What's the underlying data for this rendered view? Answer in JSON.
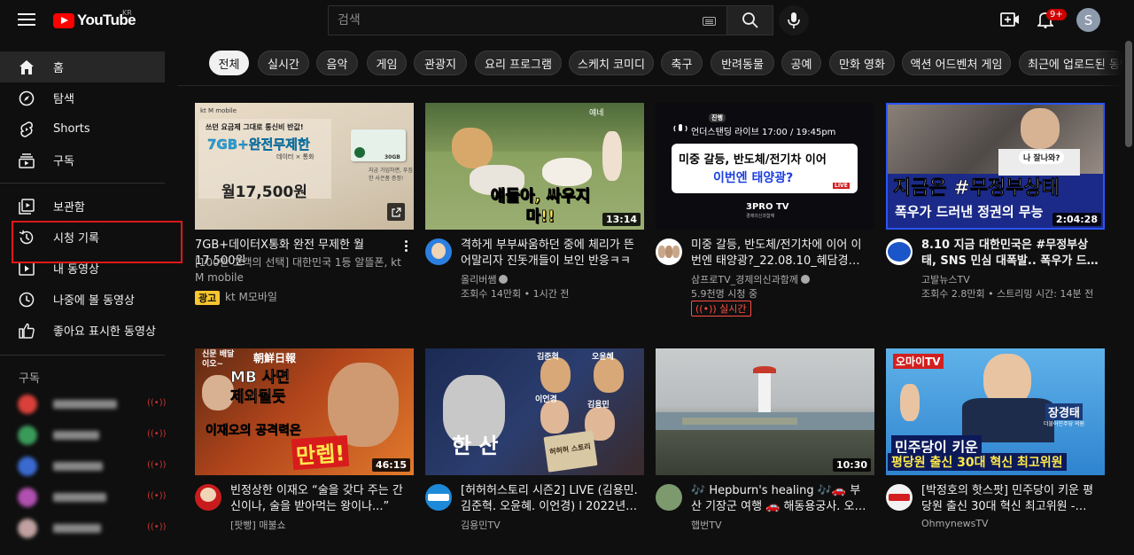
{
  "header": {
    "logo_text": "YouTube",
    "region": "KR",
    "search_placeholder": "검색",
    "notification_count": "9+",
    "avatar_letter": "S"
  },
  "sidebar": {
    "items": [
      {
        "label": "홈",
        "icon": "home-icon"
      },
      {
        "label": "탐색",
        "icon": "compass-icon"
      },
      {
        "label": "Shorts",
        "icon": "shorts-icon"
      },
      {
        "label": "구독",
        "icon": "subscriptions-icon"
      },
      {
        "label": "보관함",
        "icon": "library-icon"
      },
      {
        "label": "시청 기록",
        "icon": "history-icon"
      },
      {
        "label": "내 동영상",
        "icon": "your-videos-icon"
      },
      {
        "label": "나중에 볼 동영상",
        "icon": "watch-later-icon"
      },
      {
        "label": "좋아요 표시한 동영상",
        "icon": "like-icon"
      }
    ],
    "subscriptions_heading": "구독"
  },
  "chips": [
    "전체",
    "실시간",
    "음악",
    "게임",
    "관광지",
    "요리 프로그램",
    "스케치 코미디",
    "축구",
    "반려동물",
    "공예",
    "만화 영화",
    "액션 어드벤처 게임",
    "최근에 업로드된 동영상"
  ],
  "videos": [
    {
      "type": "ad",
      "title": "7GB+데이터X통화 완전 무제한 월 17,500원",
      "description": "[100만 고객의 선택] 대한민국 1등 알뜰폰, kt M mobile",
      "badge": "광고",
      "advertiser": "kt M모바일",
      "thumb_brand": "kt M mobile",
      "thumb_line1": "쓰던 요금제 그대로 통신비 반값!",
      "thumb_line2": "7GB+완전무제한",
      "thumb_line3": "데이터 × 통화",
      "thumb_price": "월17,500원",
      "thumb_card": "30GB",
      "thumb_note": "지금 가입하면, 푸짐한 사은품 증정!"
    },
    {
      "title": "격하게 부부싸움하던 중에 체리가 뜬 어말리자 진돗개들이 보인 반응ㅋㅋ",
      "channel": "올리버쌤",
      "verified": true,
      "stats": "조회수 14만회 • 1시간 전",
      "duration": "13:14",
      "thumb_text": "얘들아, 싸우지 마!!",
      "thumb_small": "얘네"
    },
    {
      "title": "미중 갈등, 반도체/전기차에 이어 이번엔 태양광?_22.08.10_혜담경제...",
      "channel": "삼프로TV_경제의신과함께",
      "verified": true,
      "stats": "5.9천명 시청 중",
      "live_label": "실시간",
      "thumb_top": "언더스탠딩 라이브 17:00 / 19:45pm",
      "thumb_tag": "진행",
      "thumb_line1": "미중 갈등, 반도체/전기차 이어",
      "thumb_line2": "이번엔 태양광?",
      "thumb_logo": "3PRO TV",
      "thumb_logo_sub": "경제의신과함께",
      "thumb_live": "LIVE"
    },
    {
      "title": "8.10 지금 대한민국은 #무정부상태, SNS 민심 대폭발.. 폭우가 드러낸 ...",
      "channel": "고발뉴스TV",
      "stats": "조회수 2.8만회 • 스트리밍 시간: 14분 전",
      "duration": "2:04:28",
      "thumb_line1": "지금은 #무정부상태",
      "thumb_line2": "폭우가 드러낸 정권의 무능",
      "thumb_bubble": "나 잘나와?"
    },
    {
      "title": "빈정상한 이재오 “술을 갖다 주는 간신이나, 술을 받아먹는 왕이나...”",
      "channel": "[팟빵] 매불쇼",
      "duration": "46:15",
      "thumb_line1": "MB 사면",
      "thumb_line2": "제외될듯",
      "thumb_line3": "이재오의 공격력은",
      "thumb_line4": "만렙!",
      "thumb_small": "신문 배달이오~",
      "thumb_news": "朝鮮日報"
    },
    {
      "title": "[허허허스토리 시즌2] LIVE (김용민. 김준혁. 오윤혜. 이언경) l 2022년 0...",
      "channel": "김용민TV",
      "thumb_names": [
        "김준혁",
        "오윤혜",
        "이언경",
        "김용민"
      ],
      "thumb_calli": "한 산",
      "thumb_seal": "허허허 스토리"
    },
    {
      "title": "🎶 Hepburn's healing 🎶🚗 부산 기장군 여행 🚗 해동용궁사. 오시...",
      "channel": "햅번TV",
      "duration": "10:30"
    },
    {
      "title": "[박정호의 핫스팟] 민주당이 키운 평당원 출신 30대 혁신 최고위원 - 장...",
      "channel": "OhmynewsTV",
      "thumb_brand": "오마이TV",
      "thumb_line1": "민주당이 키운",
      "thumb_line2": "평당원 출신 30대 혁신 최고위원",
      "thumb_name": "장경태",
      "thumb_name_sub": "더불어민주당 의원"
    }
  ],
  "colors": {
    "background": "#0f0f0f",
    "accent_red": "#ff0000",
    "highlight_box": "#e01818"
  }
}
